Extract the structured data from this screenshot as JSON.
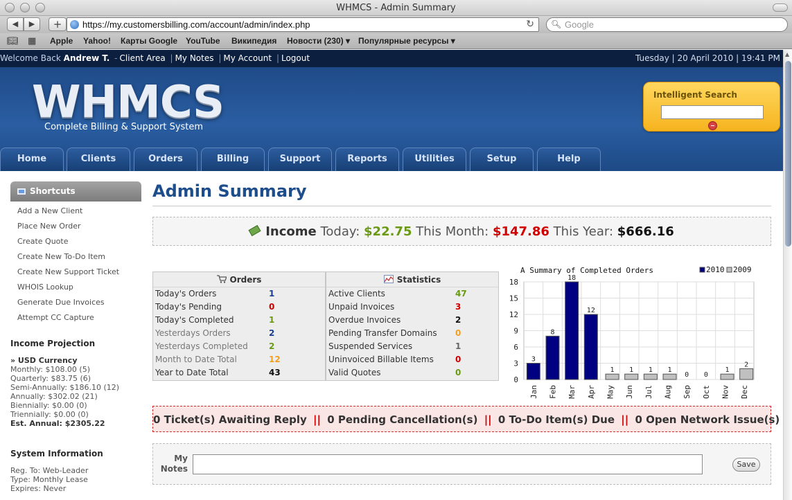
{
  "window": {
    "title": "WHMCS - Admin Summary"
  },
  "browser": {
    "url": "https://my.customersbilling.com/account/admin/index.php",
    "search_placeholder": "Google",
    "bookmarks": [
      "Apple",
      "Yahoo!",
      "Карты Google",
      "YouTube",
      "Википедия",
      "Новости (230)",
      "Популярные ресурсы"
    ]
  },
  "topbar": {
    "welcome": "Welcome Back",
    "user": "Andrew T.",
    "links": [
      "Client Area",
      "My Notes",
      "My Account",
      "Logout"
    ],
    "datetime": "Tuesday | 20 April 2010 | 19:41 PM"
  },
  "header": {
    "logo": "WHMCS",
    "tagline": "Complete Billing & Support System",
    "search_label": "Intelligent Search"
  },
  "nav": [
    "Home",
    "Clients",
    "Orders",
    "Billing",
    "Support",
    "Reports",
    "Utilities",
    "Setup",
    "Help"
  ],
  "sidebar": {
    "shortcuts_title": "Shortcuts",
    "shortcuts": [
      "Add a New Client",
      "Place New Order",
      "Create Quote",
      "Create New To-Do Item",
      "Create New Support Ticket",
      "WHOIS Lookup",
      "Generate Due Invoices",
      "Attempt CC Capture"
    ],
    "income_projection": {
      "title": "Income Projection",
      "currency": "» USD Currency",
      "lines": [
        "Monthly: $108.00 (5)",
        "Quarterly: $83.75 (6)",
        "Semi-Annually: $186.10 (12)",
        "Annually: $302.02 (21)",
        "Biennially: $0.00 (0)",
        "Triennially: $0.00 (0)"
      ],
      "est_annual": "Est. Annual: $2305.22"
    },
    "system_info": {
      "title": "System Information",
      "lines": [
        "Reg. To: Web-Leader",
        "Type: Monthly Lease",
        "Expires: Never"
      ]
    }
  },
  "main": {
    "title": "Admin Summary",
    "income": {
      "label": "Income",
      "today_label": "Today:",
      "today": "$22.75",
      "month_label": "This Month:",
      "month": "$147.86",
      "year_label": "This Year:",
      "year": "$666.16"
    },
    "orders": {
      "title": "Orders",
      "rows": [
        {
          "label": "Today's Orders",
          "value": "1",
          "color": "#1a3d8f"
        },
        {
          "label": "Today's Pending",
          "value": "0",
          "color": "#cc0000"
        },
        {
          "label": "Today's Completed",
          "value": "1",
          "color": "#6a9a12"
        },
        {
          "label": "Yesterdays Orders",
          "value": "2",
          "color": "#1a3d8f"
        },
        {
          "label": "Yesterdays Completed",
          "value": "2",
          "color": "#6a9a12"
        },
        {
          "label": "Month to Date Total",
          "value": "12",
          "color": "#f0a020"
        },
        {
          "label": "Year to Date Total",
          "value": "43",
          "color": "#111111"
        }
      ]
    },
    "statistics": {
      "title": "Statistics",
      "rows": [
        {
          "label": "Active Clients",
          "value": "47",
          "color": "#6a9a12"
        },
        {
          "label": "Unpaid Invoices",
          "value": "3",
          "color": "#cc0000"
        },
        {
          "label": "Overdue Invoices",
          "value": "2",
          "color": "#111111"
        },
        {
          "label": "Pending Transfer Domains",
          "value": "0",
          "color": "#f0a020"
        },
        {
          "label": "Suspended Services",
          "value": "1",
          "color": "#666666"
        },
        {
          "label": "Uninvoiced Billable Items",
          "value": "0",
          "color": "#cc0000"
        },
        {
          "label": "Valid Quotes",
          "value": "0",
          "color": "#6a9a12"
        }
      ]
    },
    "alerts": {
      "tickets": "0 Ticket(s) Awaiting Reply",
      "cancellations": "0 Pending Cancellation(s)",
      "todo": "0 To-Do Item(s) Due",
      "network": "0 Open Network Issue(s)",
      "separator": "||"
    },
    "notes": {
      "label_line1": "My",
      "label_line2": "Notes",
      "save": "Save"
    }
  },
  "chart_data": {
    "type": "bar",
    "title": "A Summary of Completed Orders",
    "categories": [
      "Jan",
      "Feb",
      "Mar",
      "Apr",
      "May",
      "Jun",
      "Jul",
      "Aug",
      "Sep",
      "Oct",
      "Nov",
      "Dec"
    ],
    "series": [
      {
        "name": "2010",
        "values": [
          3,
          8,
          18,
          12,
          0,
          0,
          0,
          0,
          0,
          0,
          0,
          0
        ],
        "color": "#000080"
      },
      {
        "name": "2009",
        "values": [
          0,
          0,
          0,
          0,
          1,
          1,
          1,
          1,
          0,
          0,
          1,
          2
        ],
        "color": "#c0c0c0"
      }
    ],
    "yticks": [
      0,
      3,
      6,
      9,
      12,
      15,
      18
    ],
    "ylim": [
      0,
      18
    ],
    "grid": true,
    "legend": "top-right"
  },
  "colors": {
    "header_blue": "#24528f",
    "accent_orange": "#f6b41f",
    "title_blue": "#1e4d8c"
  }
}
